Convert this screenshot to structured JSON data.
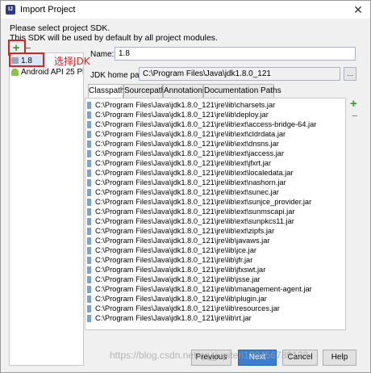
{
  "window": {
    "title": "Import Project",
    "close_glyph": "✕"
  },
  "description": {
    "line1": "Please select project SDK.",
    "line2": "This SDK will be used by default by all project modules."
  },
  "sdk_toolbar": {
    "add_glyph": "+",
    "remove_glyph": "−"
  },
  "sdk_list": {
    "items": [
      {
        "label": "1.8",
        "icon": "sdk-folder-icon",
        "selected": true
      },
      {
        "label": "Android API 25 Platform",
        "icon": "android-icon",
        "selected": false
      }
    ]
  },
  "annotation": "选择JDK",
  "form": {
    "name_label": "Name:",
    "name_value": "1.8",
    "home_label": "JDK home path:",
    "home_value": "C:\\Program Files\\Java\\jdk1.8.0_121",
    "browse_label": "..."
  },
  "tabs": [
    {
      "label": "Classpath",
      "active": true
    },
    {
      "label": "Sourcepath",
      "active": false
    },
    {
      "label": "Annotations",
      "active": false
    },
    {
      "label": "Documentation Paths",
      "active": false
    }
  ],
  "classpath": [
    "C:\\Program Files\\Java\\jdk1.8.0_121\\jre\\lib\\charsets.jar",
    "C:\\Program Files\\Java\\jdk1.8.0_121\\jre\\lib\\deploy.jar",
    "C:\\Program Files\\Java\\jdk1.8.0_121\\jre\\lib\\ext\\access-bridge-64.jar",
    "C:\\Program Files\\Java\\jdk1.8.0_121\\jre\\lib\\ext\\cldrdata.jar",
    "C:\\Program Files\\Java\\jdk1.8.0_121\\jre\\lib\\ext\\dnsns.jar",
    "C:\\Program Files\\Java\\jdk1.8.0_121\\jre\\lib\\ext\\jaccess.jar",
    "C:\\Program Files\\Java\\jdk1.8.0_121\\jre\\lib\\ext\\jfxrt.jar",
    "C:\\Program Files\\Java\\jdk1.8.0_121\\jre\\lib\\ext\\localedata.jar",
    "C:\\Program Files\\Java\\jdk1.8.0_121\\jre\\lib\\ext\\nashorn.jar",
    "C:\\Program Files\\Java\\jdk1.8.0_121\\jre\\lib\\ext\\sunec.jar",
    "C:\\Program Files\\Java\\jdk1.8.0_121\\jre\\lib\\ext\\sunjce_provider.jar",
    "C:\\Program Files\\Java\\jdk1.8.0_121\\jre\\lib\\ext\\sunmscapi.jar",
    "C:\\Program Files\\Java\\jdk1.8.0_121\\jre\\lib\\ext\\sunpkcs11.jar",
    "C:\\Program Files\\Java\\jdk1.8.0_121\\jre\\lib\\ext\\zipfs.jar",
    "C:\\Program Files\\Java\\jdk1.8.0_121\\jre\\lib\\javaws.jar",
    "C:\\Program Files\\Java\\jdk1.8.0_121\\jre\\lib\\jce.jar",
    "C:\\Program Files\\Java\\jdk1.8.0_121\\jre\\lib\\jfr.jar",
    "C:\\Program Files\\Java\\jdk1.8.0_121\\jre\\lib\\jfxswt.jar",
    "C:\\Program Files\\Java\\jdk1.8.0_121\\jre\\lib\\jsse.jar",
    "C:\\Program Files\\Java\\jdk1.8.0_121\\jre\\lib\\management-agent.jar",
    "C:\\Program Files\\Java\\jdk1.8.0_121\\jre\\lib\\plugin.jar",
    "C:\\Program Files\\Java\\jdk1.8.0_121\\jre\\lib\\resources.jar",
    "C:\\Program Files\\Java\\jdk1.8.0_121\\jre\\lib\\rt.jar"
  ],
  "list_toolbar": {
    "add_glyph": "+",
    "remove_glyph": "−"
  },
  "buttons": {
    "previous": "Previous",
    "next": "Next",
    "cancel": "Cancel",
    "help": "Help"
  },
  "watermark": "https://blog.csdn.net/qq_jupiteri123456789123"
}
